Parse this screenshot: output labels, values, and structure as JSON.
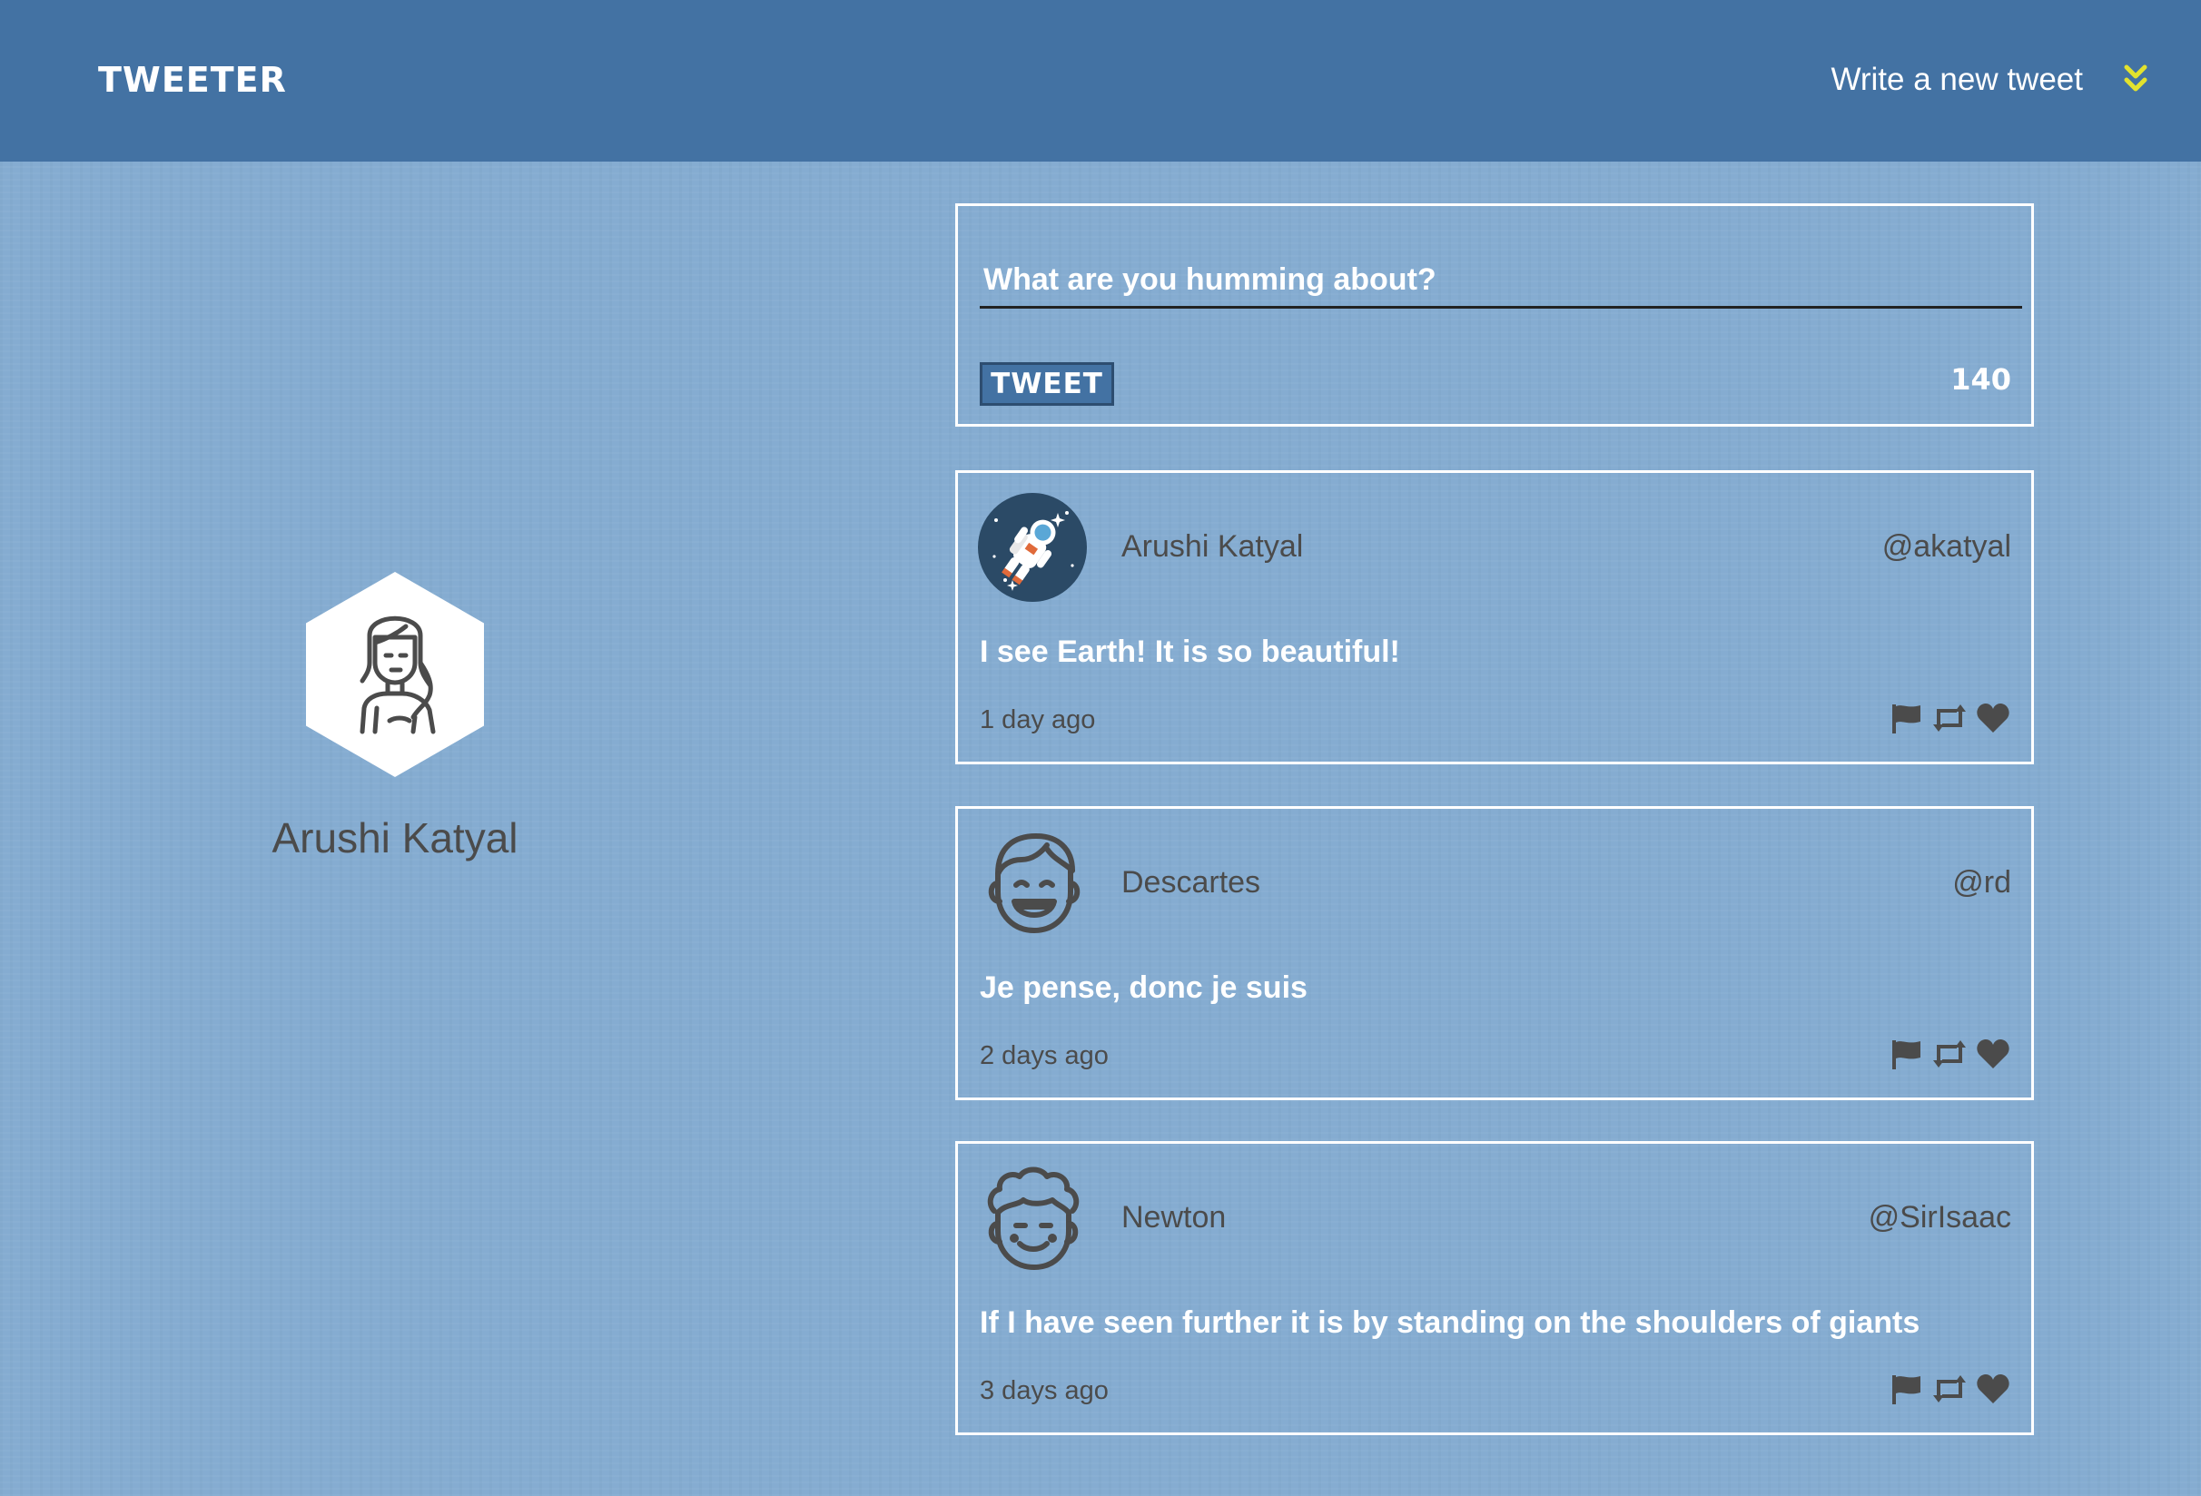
{
  "nav": {
    "brand": "TWEETER",
    "compose_link": "Write a new tweet",
    "compose_toggle_icon": "double-chevron-down-icon",
    "accent": "#e2e22e"
  },
  "profile": {
    "name": "Arushi Katyal",
    "avatar_icon": "woman-avatar-icon"
  },
  "compose": {
    "placeholder": "What are you humming about?",
    "value": "",
    "button_label": "TWEET",
    "counter": "140"
  },
  "tweets": [
    {
      "author": "Arushi Katyal",
      "handle": "@akatyal",
      "content": "I see Earth! It is so beautiful!",
      "time": "1 day ago",
      "avatar_icon": "astronaut-avatar-icon"
    },
    {
      "author": "Descartes",
      "handle": "@rd",
      "content": "Je pense, donc je suis",
      "time": "2 days ago",
      "avatar_icon": "smiling-man-avatar-icon"
    },
    {
      "author": "Newton",
      "handle": "@SirIsaac",
      "content": "If I have seen further it is by standing on the shoulders of giants",
      "time": "3 days ago",
      "avatar_icon": "curly-hair-man-avatar-icon"
    }
  ],
  "colors": {
    "background": "#85acd1",
    "navbar": "#4372a3",
    "text_dark": "#4b4b4b",
    "text_light": "#ffffff"
  }
}
